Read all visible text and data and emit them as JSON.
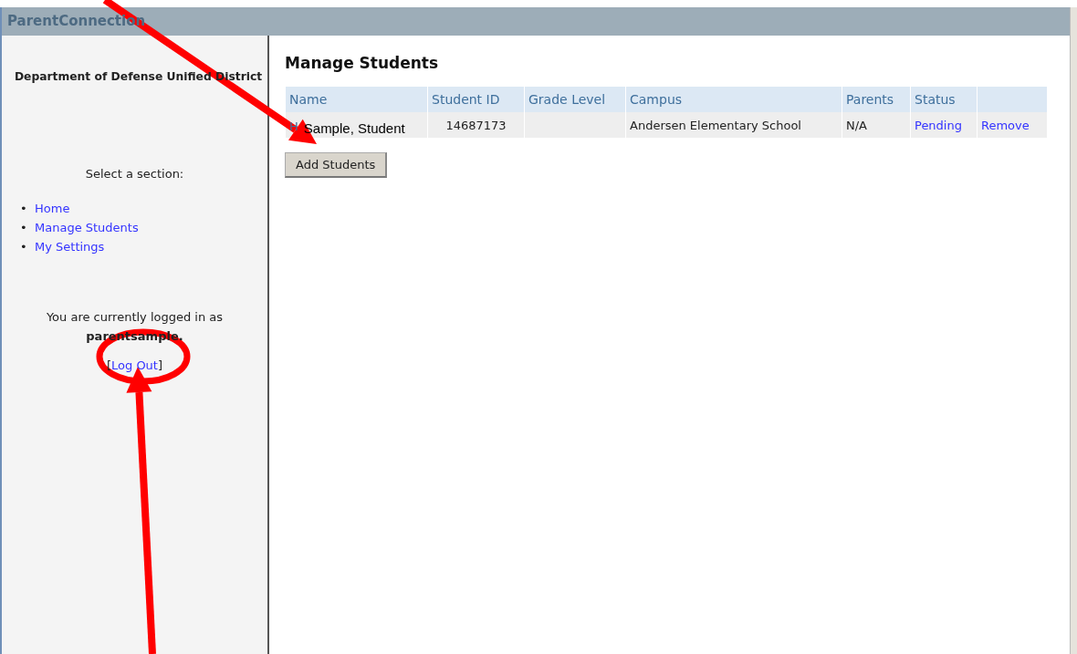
{
  "window": {
    "title": "ParentConnection"
  },
  "sidebar": {
    "district": "Department of Defense Unified District",
    "prompt": "Select a section:",
    "nav": [
      {
        "bullet": "•",
        "label": "Home"
      },
      {
        "bullet": "•",
        "label": "Manage Students"
      },
      {
        "bullet": "•",
        "label": "My Settings"
      }
    ],
    "login_text": "You are currently logged in as",
    "username": "parentsample.",
    "logout": {
      "open": "[",
      "label": "Log Out",
      "close": "]"
    }
  },
  "main": {
    "heading": "Manage Students",
    "table": {
      "columns": [
        "Name",
        "Student ID",
        "Grade Level",
        "Campus",
        "Parents",
        "Status"
      ],
      "rows": [
        {
          "name_initial": "H",
          "name": "Sample, Student",
          "student_id": "14687173",
          "campus": "Andersen Elementary School",
          "parents": "N/A",
          "status": "Pending",
          "action": "Remove"
        }
      ]
    },
    "add_button": "Add Students"
  },
  "annotations": [
    {
      "kind": "arrow"
    },
    {
      "kind": "ellipse"
    },
    {
      "kind": "arrow"
    }
  ]
}
